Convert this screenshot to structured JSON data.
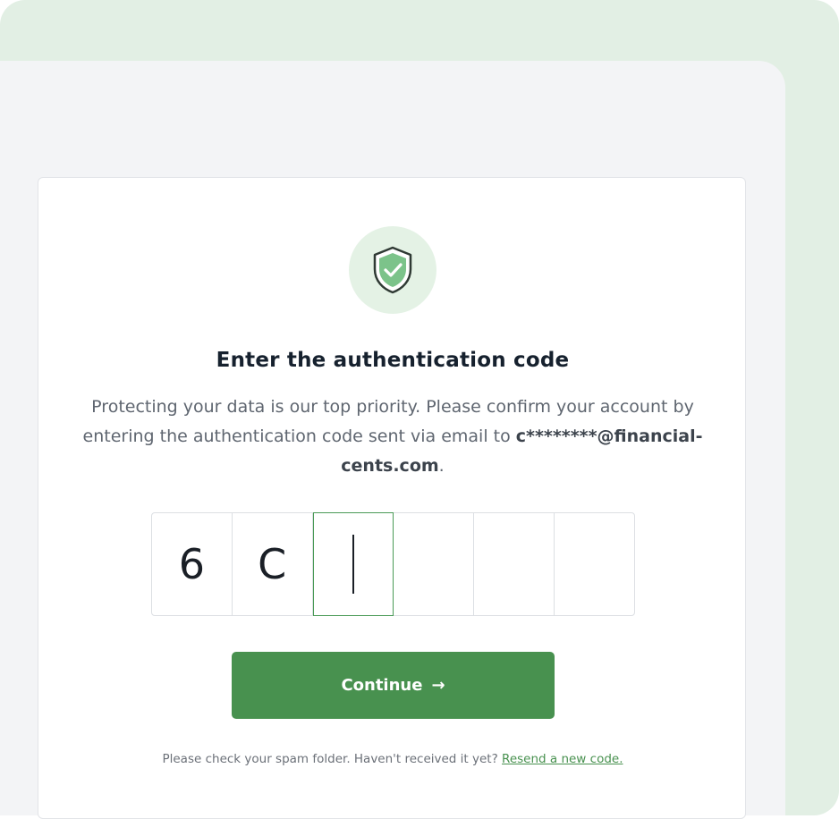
{
  "colors": {
    "outer_background": "#e2efe4",
    "panel_background": "#f3f4f6",
    "card_background": "#ffffff",
    "accent_green": "#48914f",
    "shield_circle": "#e4f2e5",
    "title_text": "#16212e"
  },
  "icons": {
    "shield": "shield-check-icon",
    "arrow": "arrow-right-icon"
  },
  "auth": {
    "title": "Enter the authentication code",
    "description_line": "Protecting your data is our top priority. Please confirm your account by entering the authentication code sent via email to",
    "email": "c********@financial-cents.com",
    "email_suffix": ".",
    "code_digits": [
      "6",
      "C",
      "",
      "",
      "",
      ""
    ],
    "active_index": 2,
    "continue_label": "Continue",
    "continue_arrow": "→",
    "footer_text": "Please check your spam folder. Haven't received it yet?",
    "resend_label": "Resend a new code."
  }
}
